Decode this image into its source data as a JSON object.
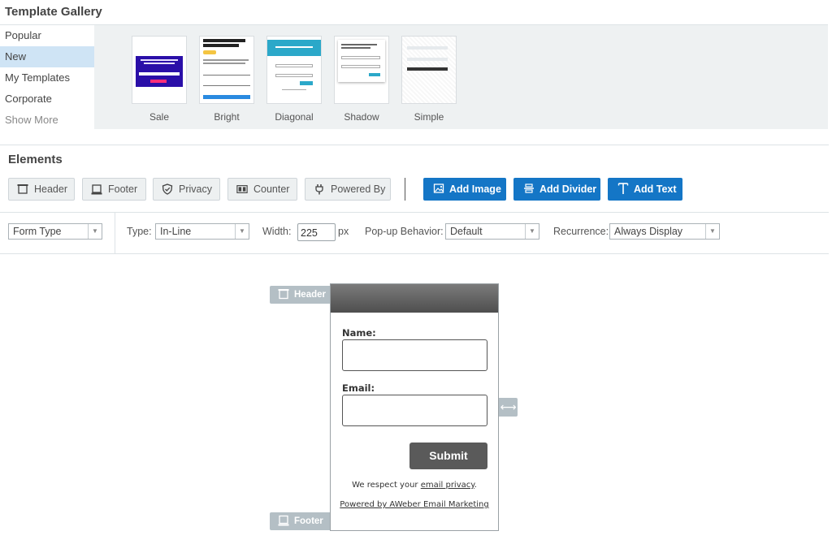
{
  "gallery": {
    "title": "Template Gallery",
    "categories": [
      "Popular",
      "New",
      "My Templates",
      "Corporate"
    ],
    "active_category": "New",
    "show_more": "Show More",
    "templates": [
      "Sale",
      "Bright",
      "Diagonal",
      "Shadow",
      "Simple"
    ]
  },
  "elements": {
    "title": "Elements",
    "buttons": [
      "Header",
      "Footer",
      "Privacy",
      "Counter",
      "Powered By"
    ],
    "add_buttons": [
      "Add Image",
      "Add Divider",
      "Add Text"
    ]
  },
  "options": {
    "form_type": "Form Type",
    "type_label": "Type:",
    "type_value": "In-Line",
    "width_label": "Width:",
    "width_value": "225",
    "width_unit": "px",
    "popup_label": "Pop-up Behavior:",
    "popup_value": "Default",
    "recurrence_label": "Recurrence:",
    "recurrence_value": "Always Display"
  },
  "canvas": {
    "header_tab": "Header",
    "footer_tab": "Footer",
    "form": {
      "name_label": "Name:",
      "email_label": "Email:",
      "submit_label": "Submit",
      "privacy_prefix": "We respect your ",
      "privacy_link": "email privacy",
      "privacy_suffix": ".",
      "powered_by": "Powered by AWeber Email Marketing"
    }
  },
  "colors": {
    "accent": "#1476c6",
    "active_category": "#cfe4f5",
    "submit": "#5a5a5a",
    "tab": "#b4bfc5"
  }
}
